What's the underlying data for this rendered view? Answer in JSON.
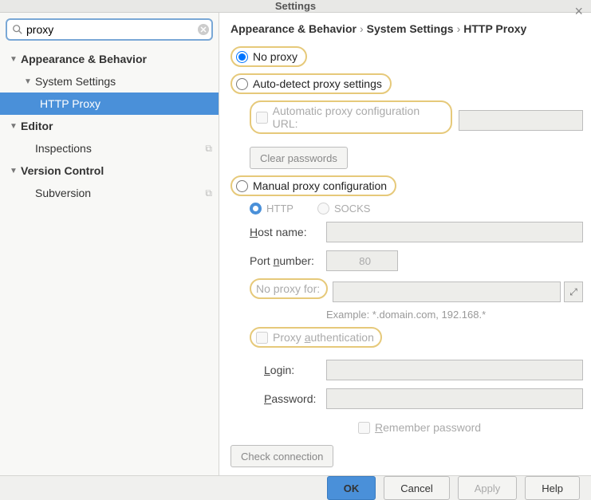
{
  "window": {
    "title": "Settings"
  },
  "search": {
    "value": "proxy"
  },
  "tree": {
    "n0": "Appearance & Behavior",
    "n1": "System Settings",
    "n2": "HTTP Proxy",
    "n3": "Editor",
    "n4": "Inspections",
    "n5": "Version Control",
    "n6": "Subversion"
  },
  "bc": {
    "a": "Appearance & Behavior",
    "b": "System Settings",
    "c": "HTTP Proxy"
  },
  "opt": {
    "none": "No proxy",
    "auto": "Auto-detect proxy settings",
    "auto_url": "Automatic proxy configuration URL:",
    "clear_pw": "Clear passwords",
    "manual": "Manual proxy configuration",
    "http": "HTTP",
    "socks": "SOCKS",
    "host": "Host name:",
    "port": "Port number:",
    "port_val": "80",
    "nofor": "No proxy for:",
    "example": "Example: *.domain.com, 192.168.*",
    "auth": "Proxy authentication",
    "login": "Login:",
    "password": "Password:",
    "remember": "Remember password",
    "check": "Check connection"
  },
  "buttons": {
    "ok": "OK",
    "cancel": "Cancel",
    "apply": "Apply",
    "help": "Help"
  }
}
